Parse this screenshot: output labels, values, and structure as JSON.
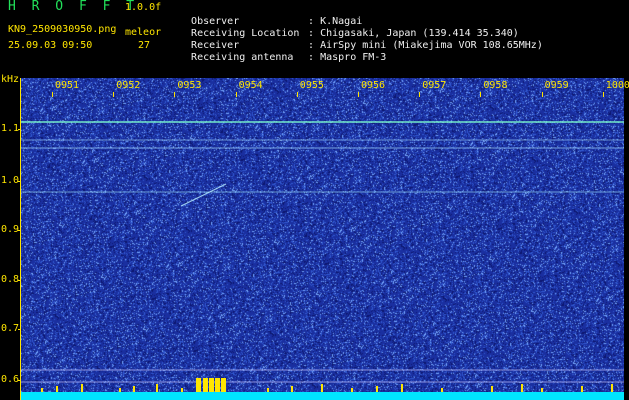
{
  "header": {
    "app_title": "H R O F F T",
    "fft_param": "1.0.0f",
    "filename": "KN9_2509030950.png",
    "mode": "meleor",
    "datetime": "25.09.03 09:50",
    "count": "27"
  },
  "info": [
    {
      "label": "Observer",
      "value": ": K.Nagai"
    },
    {
      "label": "Receiving Location",
      "value": ": Chigasaki, Japan (139.414 35.340)"
    },
    {
      "label": "Receiver",
      "value": ": AirSpy mini (Miakejima VOR 108.65MHz)"
    },
    {
      "label": "Receiving antenna",
      "value": ": Maspro FM-3"
    }
  ],
  "axis": {
    "unit": "kHz",
    "time_labels": [
      "0951",
      "0952",
      "0953",
      "0954",
      "0955",
      "0956",
      "0957",
      "0958",
      "0959",
      "1000"
    ],
    "freq_labels": [
      "1.1",
      "1.0",
      "0.9",
      "0.8",
      "0.7",
      "0.6"
    ]
  },
  "colors": {
    "background": "#000000",
    "plot_bg": "#1a2fa0",
    "axis": "#ffe600",
    "signal": "#7fffd0",
    "bottom_bar": "#00e5ff"
  }
}
